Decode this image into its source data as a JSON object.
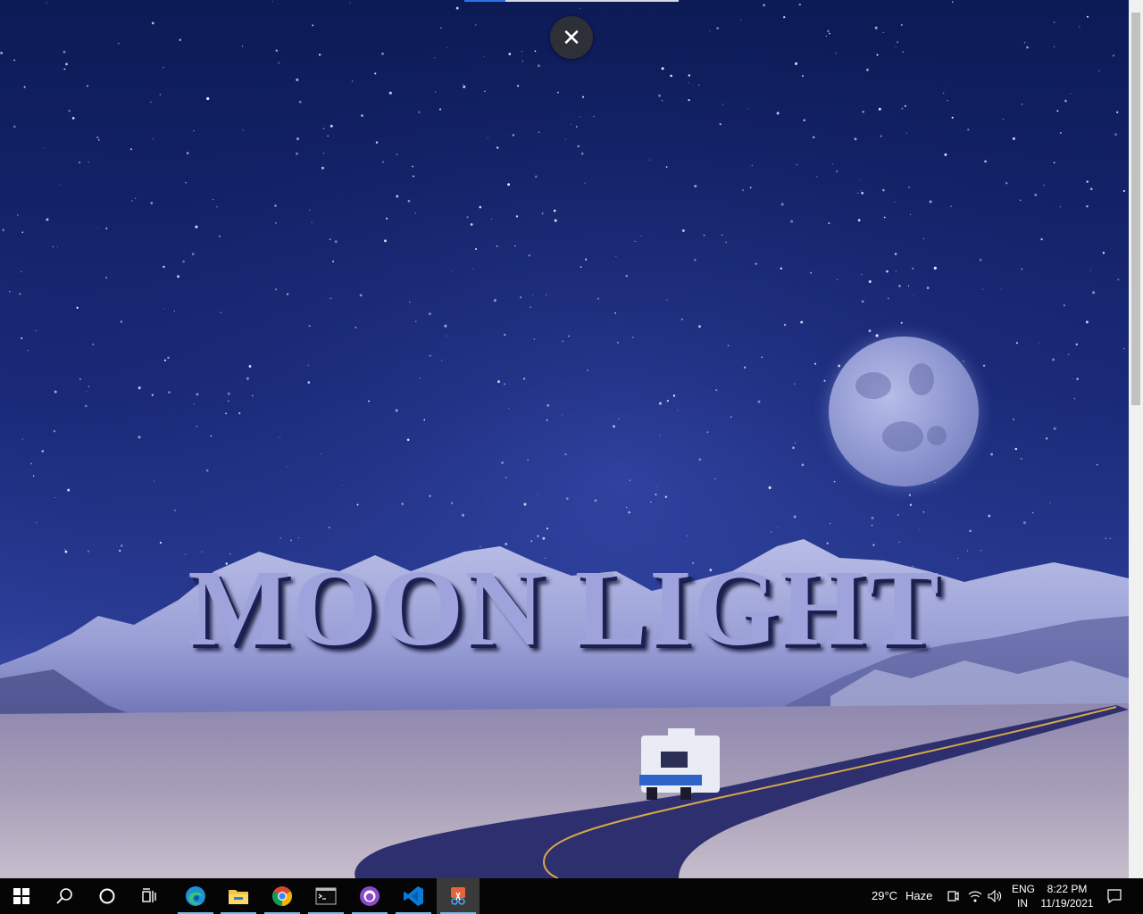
{
  "page": {
    "title_text": "MOON LIGHT",
    "close_glyph": "✕"
  },
  "colors": {
    "title": "#9fa3dc",
    "sky_top": "#0c1a55",
    "taskbar": "#050505",
    "accent": "#76b9ed"
  },
  "taskbar": {
    "start_icon": "windows-start-icon",
    "apps": [
      {
        "name": "search",
        "icon": "search-icon"
      },
      {
        "name": "cortana",
        "icon": "cortana-circle-icon"
      },
      {
        "name": "task-view",
        "icon": "task-view-icon"
      },
      {
        "name": "edge",
        "icon": "edge-icon"
      },
      {
        "name": "file-explorer",
        "icon": "folder-icon"
      },
      {
        "name": "chrome",
        "icon": "chrome-icon"
      },
      {
        "name": "terminal",
        "icon": "terminal-icon"
      },
      {
        "name": "github-desktop",
        "icon": "github-icon"
      },
      {
        "name": "vscode",
        "icon": "vscode-icon"
      },
      {
        "name": "snipping-tool",
        "icon": "snip-icon"
      }
    ],
    "weather": {
      "temp": "29°C",
      "condition": "Haze"
    },
    "language": {
      "line1": "ENG",
      "line2": "IN"
    },
    "clock": {
      "time": "8:22 PM",
      "date": "11/19/2021"
    }
  }
}
